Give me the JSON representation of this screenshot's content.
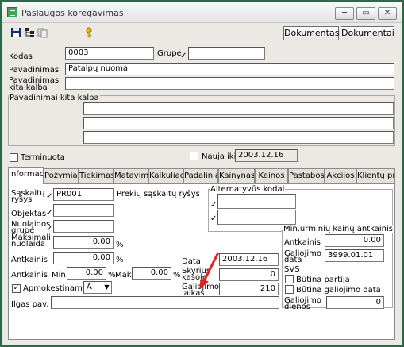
{
  "window": {
    "title": "Paslaugos koregavimas",
    "controls": {
      "minimize": "─",
      "maximize": "▭",
      "close": "✕"
    }
  },
  "toolbar": {
    "btn_dokumentas": "Dokumentas",
    "btn_dokumentai": "Dokumentai"
  },
  "form": {
    "kodas_label": "Kodas",
    "kodas_value": "0003",
    "grupe_label": "Grupė",
    "grupe_value": "",
    "pavadinimas_label": "Pavadinimas",
    "pavadinimas_value": "Patalpų nuoma",
    "pavadinimas_kita_label_1": "Pavadinimas",
    "pavadinimas_kita_label_2": "kita kalba",
    "pavadinimai_kita_label": "Pavadinimai kita kalba",
    "terminuota_label": "Terminuota",
    "nauja_iki_label": "Nauja iki",
    "nauja_iki_value": "2003.12.16"
  },
  "tabs": [
    "Informac",
    "Požymiai",
    "Tiekimas",
    "Matavima",
    "Kalkuliac",
    "Padalinia",
    "Kainynas",
    "Kainos",
    "Pastabos",
    "Akcijos",
    "Klientų pr"
  ],
  "info": {
    "saskaitu_label_1": "Sąskaitų",
    "saskaitu_label_2": "ryšys",
    "saskaitu_value": "PR001",
    "prekiu_label": "Prekių sąskaitų ryšys",
    "objektas_label": "Objektas",
    "nuolaidos_label_1": "Nuolaidos",
    "nuolaidos_label_2": "grupė",
    "maks_label_1": "Maksimali",
    "maks_label_2": "nuolaida",
    "maks_value": "0.00",
    "pct": "%",
    "antkainis_label": "Antkainis",
    "antkainis_value": "0.00",
    "antkainis2_label": "Antkainis",
    "min_label": "Min.",
    "min_value": "0.00",
    "mak_label": "Mak.",
    "mak_value": "0.00",
    "apmok_label": "Apmokestinama",
    "apmok_value": "A",
    "ilgas_label": "Ilgas pav.",
    "alt_kodai_title": "Alternatyvūs kodai",
    "data_label": "Data",
    "data_value": "2003.12.16",
    "skyrius_label_1": "Skyrius",
    "skyrius_label_2": "kasoje",
    "skyrius_value": "0",
    "galiojimo_label_1": "Galiojimo",
    "galiojimo_label_2": "laikas",
    "galiojimo_value": "210",
    "min_urm_title": "Min.urminių kainų antkainis",
    "min_antkainis_label": "Antkainis",
    "min_antkainis_value": "0.00",
    "min_galiojimo_label_1": "Galiojimo",
    "min_galiojimo_label_2": "data",
    "min_galiojimo_value": "3999.01.01",
    "svs_title": "SVS",
    "butina_partija_label": "Būtina partija",
    "butina_galiojimo_label": "Būtina galiojimo data",
    "galiojimo_dienos_label_1": "Galiojimo",
    "galiojimo_dienos_label_2": "dienos",
    "galiojimo_dienos_value": "0"
  },
  "colors": {
    "frame": "#ece9e4",
    "accent_arrow": "#e02020",
    "border": "#2a6a4a"
  }
}
